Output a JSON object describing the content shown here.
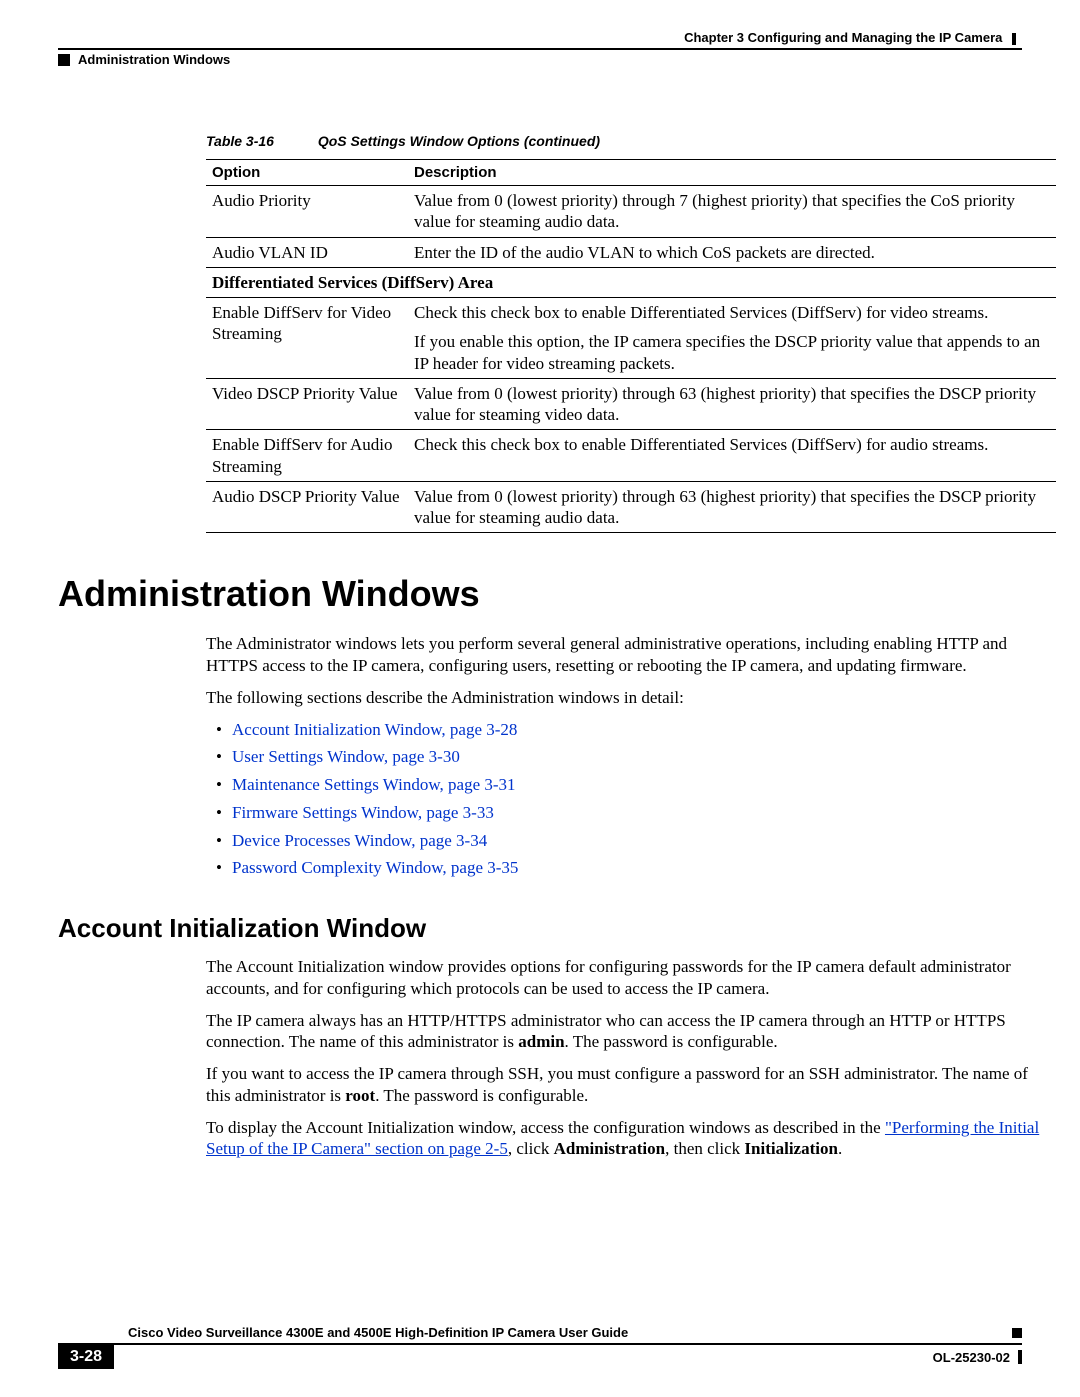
{
  "header": {
    "chapter": "Chapter 3      Configuring and Managing the IP Camera",
    "section": "Administration Windows"
  },
  "table": {
    "caption_num": "Table 3-16",
    "caption_title": "QoS Settings Window Options (continued)",
    "col1": "Option",
    "col2": "Description",
    "rows": [
      {
        "opt": "Audio Priority",
        "desc": "Value from 0 (lowest priority) through 7 (highest priority) that specifies the CoS priority value for steaming audio data."
      },
      {
        "opt": "Audio VLAN ID",
        "desc": "Enter the ID of the audio VLAN to which CoS packets are directed."
      }
    ],
    "section_row": "Differentiated Services (DiffServ) Area",
    "rows2": [
      {
        "opt": "Enable DiffServ for Video Streaming",
        "desc1": "Check this check box to enable Differentiated Services (DiffServ) for video streams.",
        "desc2": "If you enable this option, the IP camera specifies the DSCP priority value that appends to an IP header for video streaming packets."
      },
      {
        "opt": "Video DSCP Priority Value",
        "desc": "Value from 0 (lowest priority) through 63 (highest priority) that specifies the DSCP priority value for steaming video data."
      },
      {
        "opt": "Enable DiffServ for Audio Streaming",
        "desc": "Check this check box to enable Differentiated Services (DiffServ) for audio streams."
      },
      {
        "opt": "Audio DSCP Priority Value",
        "desc": "Value from 0 (lowest priority) through 63 (highest priority) that specifies the DSCP priority value for steaming audio data."
      }
    ]
  },
  "h1": "Administration Windows",
  "intro1": "The Administrator windows lets you perform several general administrative operations, including enabling HTTP and HTTPS access to the IP camera, configuring users, resetting or rebooting the IP camera, and updating firmware.",
  "intro2": "The following sections describe the Administration windows in detail:",
  "links": [
    "Account Initialization Window, page 3-28",
    "User Settings Window, page 3-30",
    "Maintenance Settings Window, page 3-31",
    "Firmware Settings Window, page 3-33",
    "Device Processes Window, page 3-34",
    "Password Complexity Window, page 3-35"
  ],
  "h2": "Account Initialization Window",
  "p1": "The Account Initialization window provides options for configuring passwords for the IP camera default administrator accounts, and for configuring which protocols can be used to access the IP camera.",
  "p2a": "The IP camera always has an HTTP/HTTPS administrator who can access the IP camera through an HTTP or HTTPS connection. The name of this administrator is ",
  "p2b": "admin",
  "p2c": ". The password is configurable.",
  "p3a": "If you want to access the IP camera through SSH, you must configure a password for an SSH administrator. The name of this administrator is ",
  "p3b": "root",
  "p3c": ". The password is configurable.",
  "p4a": "To display the Account Initialization window, access the configuration windows as described in the ",
  "p4link": "\"Performing the Initial Setup of the IP Camera\" section on page 2-5",
  "p4b": ", click ",
  "p4c": "Administration",
  "p4d": ", then click ",
  "p4e": "Initialization",
  "p4f": ".",
  "footer": {
    "title": "Cisco Video Surveillance 4300E and 4500E High-Definition IP Camera User Guide",
    "page": "3-28",
    "docnum": "OL-25230-02"
  }
}
